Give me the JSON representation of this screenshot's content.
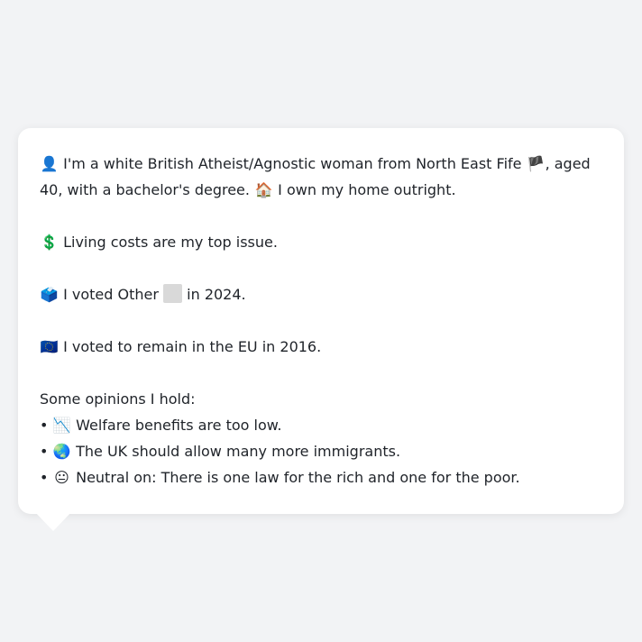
{
  "profile": {
    "line1": {
      "icon": "👤",
      "text_a": "I'm a white British Atheist/Agnostic woman from North East Fife",
      "flag": "🏴",
      "text_b": ", aged 40, with a bachelor's degree.",
      "home_icon": "🏠",
      "text_c": "I own my home outright."
    },
    "issue": {
      "icon": "💲",
      "text": "Living costs are my top issue."
    },
    "vote2024": {
      "icon": "🗳️",
      "text_a": "I voted Other",
      "text_b": "in 2024."
    },
    "eu": {
      "icon": "🇪🇺",
      "text": "I voted to remain in the EU in 2016."
    },
    "opinions_heading": "Some opinions I hold:",
    "opinions": [
      {
        "bullet": "•",
        "icon": "📉",
        "text": "Welfare benefits are too low."
      },
      {
        "bullet": "•",
        "icon": "🌏",
        "text": "The UK should allow many more immigrants."
      },
      {
        "bullet": "•",
        "icon": "😐",
        "text": "Neutral on: There is one law for the rich and one for the poor."
      }
    ]
  },
  "colors": {
    "background": "#f2f3f5",
    "bubble": "#ffffff",
    "text": "#1f2329",
    "party_box": "#d9d9d9"
  }
}
